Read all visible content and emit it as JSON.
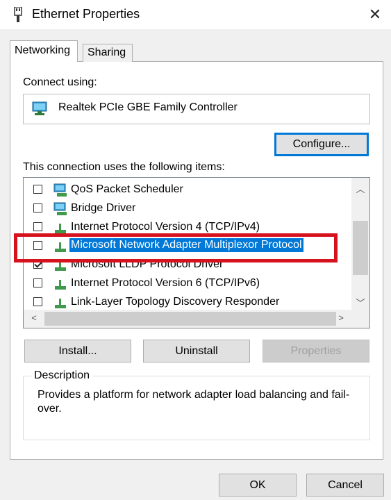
{
  "window": {
    "title": "Ethernet Properties",
    "close_glyph": "✕"
  },
  "tabs": [
    {
      "label": "Networking",
      "active": true
    },
    {
      "label": "Sharing",
      "active": false
    }
  ],
  "connect_using_label": "Connect using:",
  "adapter": {
    "name": "Realtek PCIe GBE Family Controller",
    "icon": "network-adapter-icon"
  },
  "configure_button": "Configure...",
  "items_label": "This connection uses the following items:",
  "items": [
    {
      "label": "QoS Packet Scheduler",
      "checked": false,
      "icon": "network-service-icon"
    },
    {
      "label": "Bridge Driver",
      "checked": false,
      "icon": "network-service-icon"
    },
    {
      "label": "Internet Protocol Version 4 (TCP/IPv4)",
      "checked": false,
      "icon": "protocol-icon"
    },
    {
      "label": "Microsoft Network Adapter Multiplexor Protocol",
      "checked": false,
      "icon": "protocol-icon",
      "selected": true
    },
    {
      "label": "Microsoft LLDP Protocol Driver",
      "checked": true,
      "icon": "protocol-icon"
    },
    {
      "label": "Internet Protocol Version 6 (TCP/IPv6)",
      "checked": false,
      "icon": "protocol-icon"
    },
    {
      "label": "Link-Layer Topology Discovery Responder",
      "checked": false,
      "icon": "protocol-icon"
    }
  ],
  "buttons": {
    "install": "Install...",
    "uninstall": "Uninstall",
    "properties": "Properties"
  },
  "description": {
    "legend": "Description",
    "text": "Provides a platform for network adapter load balancing and fail-over."
  },
  "footer": {
    "ok": "OK",
    "cancel": "Cancel"
  },
  "colors": {
    "selection": "#0078d7",
    "highlight_box": "#d7121f"
  }
}
